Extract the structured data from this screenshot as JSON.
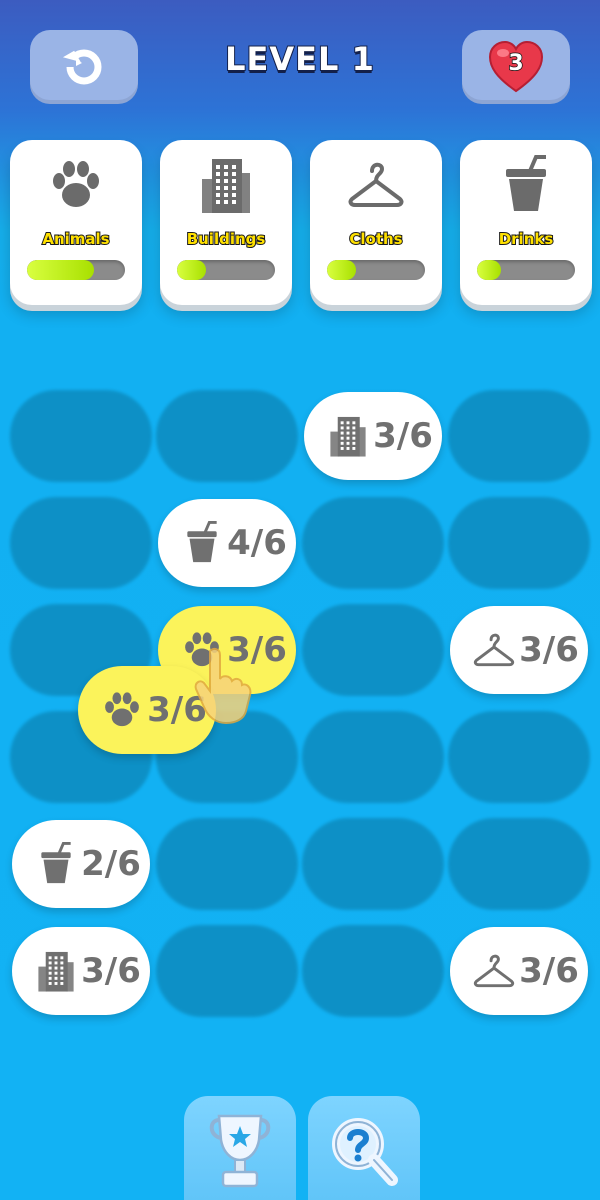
{
  "header": {
    "title": "LEVEL 1",
    "lives": "3",
    "restart_icon": "restart-icon",
    "lives_icon": "heart-icon"
  },
  "categories": [
    {
      "label": "Animals",
      "icon": "paw-icon",
      "progress": 0.68
    },
    {
      "label": "Buildings",
      "icon": "building-icon",
      "progress": 0.3
    },
    {
      "label": "Cloths",
      "icon": "hanger-icon",
      "progress": 0.3
    },
    {
      "label": "Drinks",
      "icon": "cup-icon",
      "progress": 0.24
    }
  ],
  "board": {
    "tiles": [
      {
        "row": 1,
        "col": 3,
        "icon": "building-icon",
        "count": "3/6"
      },
      {
        "row": 2,
        "col": 2,
        "icon": "cup-icon",
        "count": "4/6"
      },
      {
        "row": 3,
        "col": 2,
        "icon": "paw-icon",
        "count": "3/6",
        "selected": true
      },
      {
        "row": 3,
        "col": 4,
        "icon": "hanger-icon",
        "count": "3/6"
      },
      {
        "row": 5,
        "col": 1,
        "icon": "cup-icon",
        "count": "2/6"
      },
      {
        "row": 6,
        "col": 1,
        "icon": "building-icon",
        "count": "3/6"
      },
      {
        "row": 6,
        "col": 4,
        "icon": "hanger-icon",
        "count": "3/6"
      }
    ],
    "dragging_tile": {
      "icon": "paw-icon",
      "count": "3/6"
    }
  },
  "footer": {
    "buttons": [
      {
        "name": "trophy-button",
        "icon": "trophy-icon"
      },
      {
        "name": "search-hint-button",
        "icon": "search-hint-icon"
      }
    ]
  },
  "colors": {
    "highlight_tile": "#fbf35b",
    "category_label": "#ffe000",
    "progress_fill": "#bff01e",
    "background": "#12b2f4"
  }
}
